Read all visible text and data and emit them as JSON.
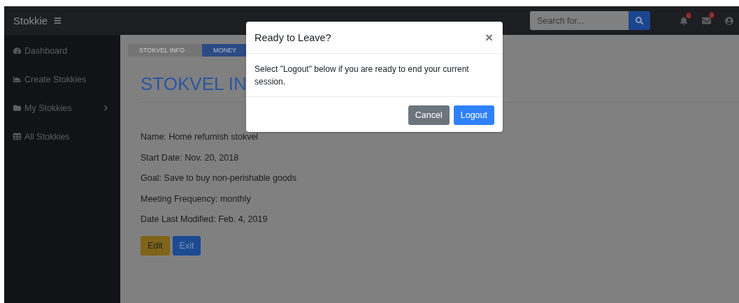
{
  "navbar": {
    "brand": "Stokkie",
    "search": {
      "placeholder": "Search for..."
    },
    "alerts_count": "0",
    "messages_count": "0"
  },
  "sidebar": {
    "items": [
      {
        "label": "Dashboard",
        "has_submenu": false
      },
      {
        "label": "Create Stokkies",
        "has_submenu": false
      },
      {
        "label": "My Stokkies",
        "has_submenu": true
      },
      {
        "label": "All Stokkies",
        "has_submenu": false
      }
    ]
  },
  "tabs": [
    {
      "label": "STOKVEL INFO",
      "selected": false
    },
    {
      "label": "MONEY",
      "selected": true
    }
  ],
  "heading": "STOKVEL IN",
  "details": [
    "Name: Home refurnish stokvel",
    "Start Date: Nov. 20, 2018",
    "Goal: Save to buy non-perishable goods",
    "Meeting Frequency: monthly",
    "Date Last Modified: Feb. 4, 2019"
  ],
  "actions": [
    {
      "label": "Edit",
      "kind": "warning"
    },
    {
      "label": "Exit",
      "kind": "primary"
    }
  ],
  "modal": {
    "title": "Ready to Leave?",
    "close": "×",
    "message": "Select \"Logout\" below if you are ready to end your current session.",
    "buttons": [
      {
        "label": "Cancel",
        "kind": "secondary"
      },
      {
        "label": "Logout",
        "kind": "primary"
      }
    ]
  }
}
